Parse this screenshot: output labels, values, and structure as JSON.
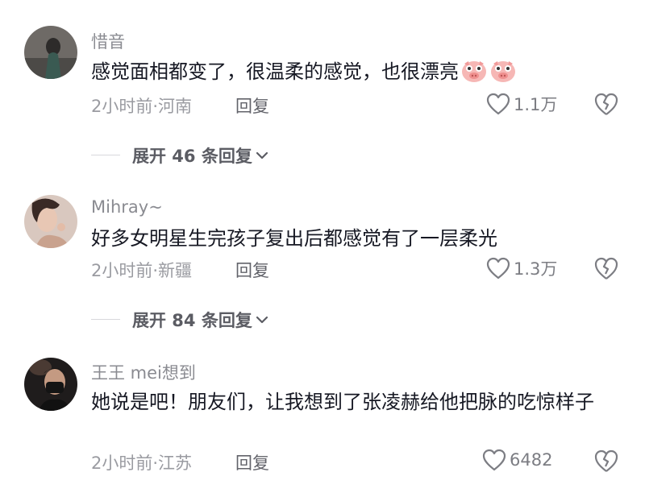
{
  "comments": [
    {
      "username": "惜音",
      "text": "感觉面相都变了，很温柔的感觉，也很漂亮",
      "emojis": [
        "pig-emoji",
        "pig-emoji"
      ],
      "time_location": "2小时前·河南",
      "reply_label": "回复",
      "likes": "1.1万",
      "expand": {
        "line": "",
        "label": "展开 46 条回复"
      }
    },
    {
      "username": "Mihray~",
      "text": "好多女明星生完孩子复出后都感觉有了一层柔光",
      "time_location": "2小时前·新疆",
      "reply_label": "回复",
      "likes": "1.3万",
      "expand": {
        "line": "",
        "label": "展开 84 条回复"
      }
    },
    {
      "username": "王王 mei想到",
      "text": "她说是吧！朋友们，让我想到了张凌赫给他把脉的吃惊样子",
      "time_location": "2小时前·江苏",
      "reply_label": "回复",
      "likes": "6482"
    }
  ],
  "icons": {
    "like": "heart-outline-icon",
    "dislike": "broken-heart-icon",
    "expand": "chevron-down-icon"
  }
}
